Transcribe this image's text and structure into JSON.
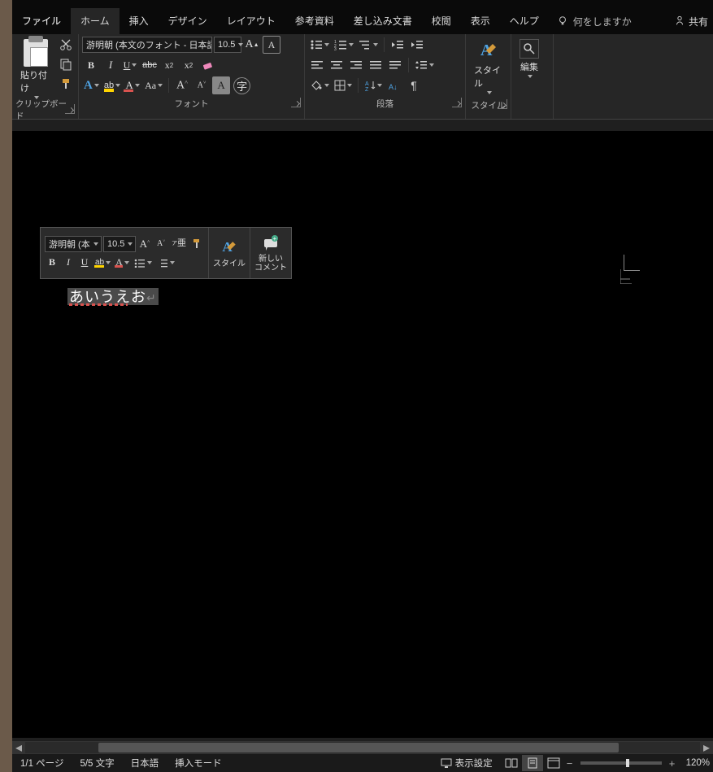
{
  "tabs": {
    "file": "ファイル",
    "home": "ホーム",
    "insert": "挿入",
    "design": "デザイン",
    "layout": "レイアウト",
    "references": "参考資料",
    "mailings": "差し込み文書",
    "review": "校閲",
    "view": "表示",
    "help": "ヘルプ",
    "tell_me": "何をしますか",
    "share": "共有"
  },
  "ribbon": {
    "clipboard": {
      "paste": "貼り付け",
      "label": "クリップボード"
    },
    "font": {
      "name": "游明朝 (本文のフォント - 日本語",
      "size": "10.5",
      "label": "フォント"
    },
    "paragraph": {
      "label": "段落"
    },
    "styles": {
      "button": "スタイル",
      "label": "スタイル"
    },
    "editing": {
      "button": "編集"
    }
  },
  "mini": {
    "font": "游明朝 (本",
    "size": "10.5",
    "styles": "スタイル",
    "comment1": "新しい",
    "comment2": "コメント",
    "ruby": "ア",
    "ruby2": "亜"
  },
  "document": {
    "text": "あいうえお",
    "paragraph_mark": "↵"
  },
  "status": {
    "page": "1/1 ページ",
    "words": "5/5 文字",
    "lang": "日本語",
    "mode": "挿入モード",
    "display": "表示設定",
    "zoom": "120%"
  }
}
